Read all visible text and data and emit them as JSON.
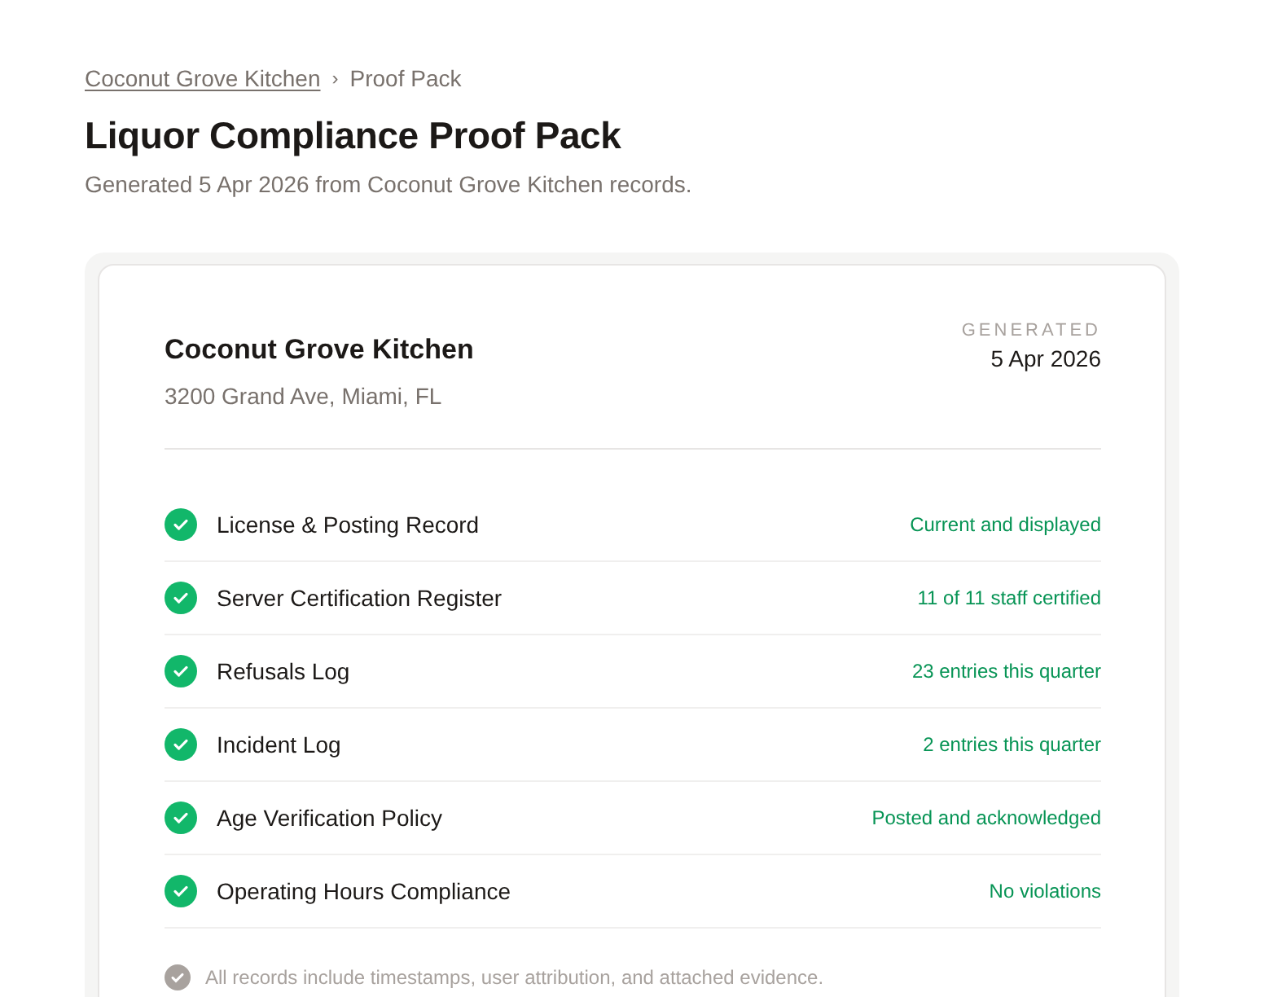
{
  "breadcrumb": {
    "link": "Coconut Grove Kitchen",
    "separator": "›",
    "current": "Proof Pack"
  },
  "title": "Liquor Compliance Proof Pack",
  "subtitle": "Generated 5 Apr 2026 from Coconut Grove Kitchen records.",
  "card": {
    "venue": "Coconut Grove Kitchen",
    "address": "3200 Grand Ave, Miami, FL",
    "generated_label": "GENERATED",
    "generated_date": "5 Apr 2026",
    "records": [
      {
        "name": "License & Posting Record",
        "status": "Current and displayed",
        "ok": true
      },
      {
        "name": "Server Certification Register",
        "status": "11 of 11 staff certified",
        "ok": true
      },
      {
        "name": "Refusals Log",
        "status": "23 entries this quarter",
        "ok": true
      },
      {
        "name": "Incident Log",
        "status": "2 entries this quarter",
        "ok": true
      },
      {
        "name": "Age Verification Policy",
        "status": "Posted and acknowledged",
        "ok": true
      },
      {
        "name": "Operating Hours Compliance",
        "status": "No violations",
        "ok": true
      }
    ],
    "footnote": "All records include timestamps, user attribution, and attached evidence."
  }
}
